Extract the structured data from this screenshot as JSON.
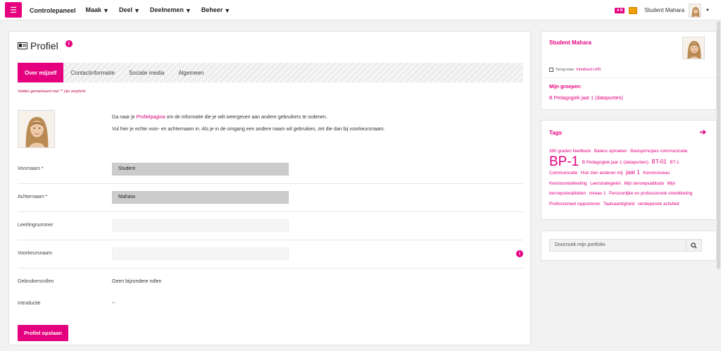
{
  "nav": {
    "menu_icon": "hamburger-icon",
    "items": [
      {
        "label": "Controlepaneel",
        "dropdown": false
      },
      {
        "label": "Maak",
        "dropdown": true
      },
      {
        "label": "Deel",
        "dropdown": true
      },
      {
        "label": "Deelnemen",
        "dropdown": true
      },
      {
        "label": "Beheer",
        "dropdown": true
      }
    ],
    "user_name": "Student Mahara",
    "accent_color": "#e4007f"
  },
  "page": {
    "title": "Profiel",
    "tabs": [
      {
        "label": "Over mijzelf",
        "active": true
      },
      {
        "label": "Contactinformatie",
        "active": false
      },
      {
        "label": "Sociale media",
        "active": false
      },
      {
        "label": "Algemeen",
        "active": false
      }
    ],
    "required_note": "Velden gemarkeerd met '*' zijn verplicht.",
    "intro_line1_pre": "Ga naar je ",
    "intro_line1_link": "Profielpagina",
    "intro_line1_post": " om de informatie die je wilt weergeven aan andere gebruikers te ordenen.",
    "intro_line2": "Vul hier je echte voor- en achternaam in. Als je in de omgang een andere naam wil gebruiken, zet die dan bij voorkeursnaam.",
    "fields": {
      "firstname": {
        "label": "Voornaam *",
        "value": "Student"
      },
      "lastname": {
        "label": "Achternaam *",
        "value": "Mahara"
      },
      "studentid": {
        "label": "Leerlingnummer",
        "value": ""
      },
      "preferredname": {
        "label": "Voorkeursnaam",
        "value": ""
      },
      "roles": {
        "label": "Gebruikersrollen",
        "value": "Geen bijzondere rollen"
      },
      "introduction": {
        "label": "Introductie",
        "value": "--"
      }
    },
    "save_label": "Profiel opslaan"
  },
  "sidebar": {
    "user_name": "Student Mahara",
    "back_pre": "Terug naar ",
    "back_link": "Inholland LMS",
    "groups_title": "Mijn groepen:",
    "group_link": "B Pedagogiek jaar 1 (datapunten)",
    "tags_title": "Tags",
    "tags": [
      {
        "label": "360 graden feedback",
        "size": "sm"
      },
      {
        "label": "Balans opmaken",
        "size": "sm"
      },
      {
        "label": "Basisprincipes communicatie",
        "size": "sm"
      },
      {
        "label": "BP-1",
        "size": "big"
      },
      {
        "label": "B Pedagogiek jaar 1 (datapunten)",
        "size": "sm"
      },
      {
        "label": "BT-01",
        "size": "md"
      },
      {
        "label": "BT-1",
        "size": "sm"
      },
      {
        "label": "Communicatie",
        "size": "sm"
      },
      {
        "label": "Hoe zien anderen mij",
        "size": "sm"
      },
      {
        "label": "jaar 1",
        "size": "md"
      },
      {
        "label": "Kennisniveau",
        "size": "sm"
      },
      {
        "label": "Kennisontwikkeling",
        "size": "sm"
      },
      {
        "label": "Leerstrategieën",
        "size": "sm"
      },
      {
        "label": "Mijn beroepsattitude",
        "size": "sm"
      },
      {
        "label": "Mijn beroepskwaliteiten",
        "size": "sm"
      },
      {
        "label": "niveau 1",
        "size": "sm"
      },
      {
        "label": "Persoonlijke en professionele ontwikkeling",
        "size": "sm"
      },
      {
        "label": "Professioneel rapporteren",
        "size": "sm"
      },
      {
        "label": "Taalvaardigheid",
        "size": "sm"
      },
      {
        "label": "verdiepende activiteit",
        "size": "sm"
      }
    ],
    "search_placeholder": "Doorzoek mijn portfolio"
  }
}
